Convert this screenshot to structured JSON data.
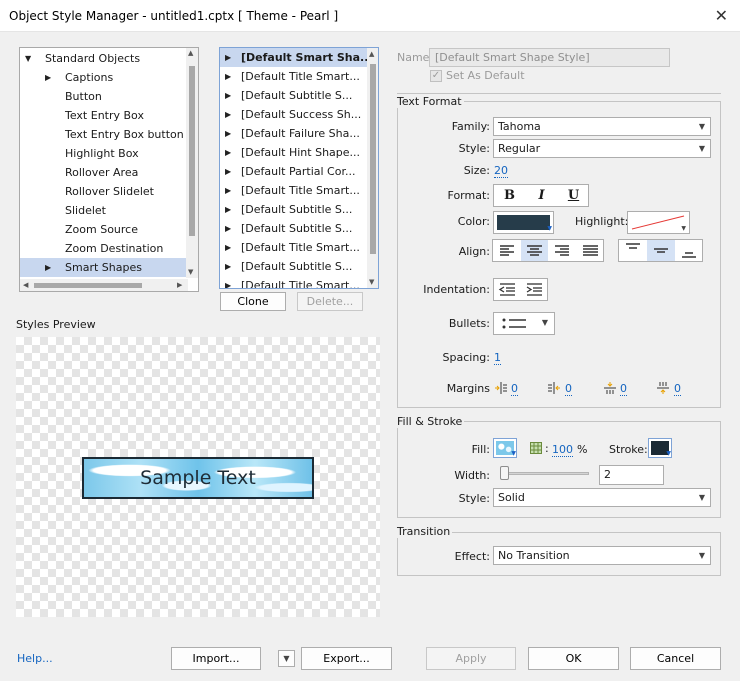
{
  "window": {
    "title": "Object Style Manager - untitled1.cptx [ Theme - Pearl ]"
  },
  "tree": {
    "items": [
      {
        "label": "Standard Objects",
        "level": 0,
        "expanded": true
      },
      {
        "label": "Captions",
        "level": 1,
        "collapsed": true
      },
      {
        "label": "Button",
        "level": 1
      },
      {
        "label": "Text Entry Box",
        "level": 1
      },
      {
        "label": "Text Entry Box button",
        "level": 1
      },
      {
        "label": "Highlight Box",
        "level": 1
      },
      {
        "label": "Rollover Area",
        "level": 1
      },
      {
        "label": "Rollover Slidelet",
        "level": 1
      },
      {
        "label": "Slidelet",
        "level": 1
      },
      {
        "label": "Zoom Source",
        "level": 1
      },
      {
        "label": "Zoom Destination",
        "level": 1
      },
      {
        "label": "Smart Shapes",
        "level": 1,
        "collapsed": true,
        "selected": true
      }
    ]
  },
  "styles_list": {
    "items": [
      "[Default Smart Sha...",
      "[Default Title Smart...",
      "[Default Subtitle S...",
      "[Default Success Sh...",
      "[Default Failure Sha...",
      "[Default Hint Shape...",
      "[Default Partial Cor...",
      "[Default Title Smart...",
      "[Default Subtitle S...",
      "[Default Subtitle S...",
      "[Default Title Smart...",
      "[Default Subtitle S...",
      "[Default Title Smart..."
    ],
    "clone_label": "Clone",
    "delete_label": "Delete..."
  },
  "preview": {
    "heading": "Styles Preview",
    "sample_text": "Sample Text"
  },
  "name_field": {
    "label": "Name",
    "value": "[Default Smart Shape Style]",
    "set_default_label": "Set As Default"
  },
  "text_format": {
    "heading": "Text Format",
    "family_label": "Family:",
    "family_value": "Tahoma",
    "style_label": "Style:",
    "style_value": "Regular",
    "size_label": "Size:",
    "size_value": "20",
    "format_label": "Format:",
    "bold": "B",
    "italic": "I",
    "underline": "U",
    "color_label": "Color:",
    "color_value": "#263c4a",
    "highlight_label": "Highlight:",
    "align_label": "Align:",
    "indentation_label": "Indentation:",
    "bullets_label": "Bullets:",
    "spacing_label": "Spacing:",
    "spacing_value": "1",
    "margins_label": "Margins",
    "margin_values": [
      "0",
      "0",
      "0",
      "0"
    ]
  },
  "fill_stroke": {
    "heading": "Fill & Stroke",
    "fill_label": "Fill:",
    "opacity_value": "100",
    "percent": "%",
    "stroke_label": "Stroke:",
    "width_label": "Width:",
    "width_value": "2",
    "style_label": "Style:",
    "style_value": "Solid"
  },
  "transition": {
    "heading": "Transition",
    "effect_label": "Effect:",
    "effect_value": "No Transition"
  },
  "footer": {
    "help": "Help...",
    "import": "Import...",
    "export": "Export...",
    "apply": "Apply",
    "ok": "OK",
    "cancel": "Cancel"
  }
}
